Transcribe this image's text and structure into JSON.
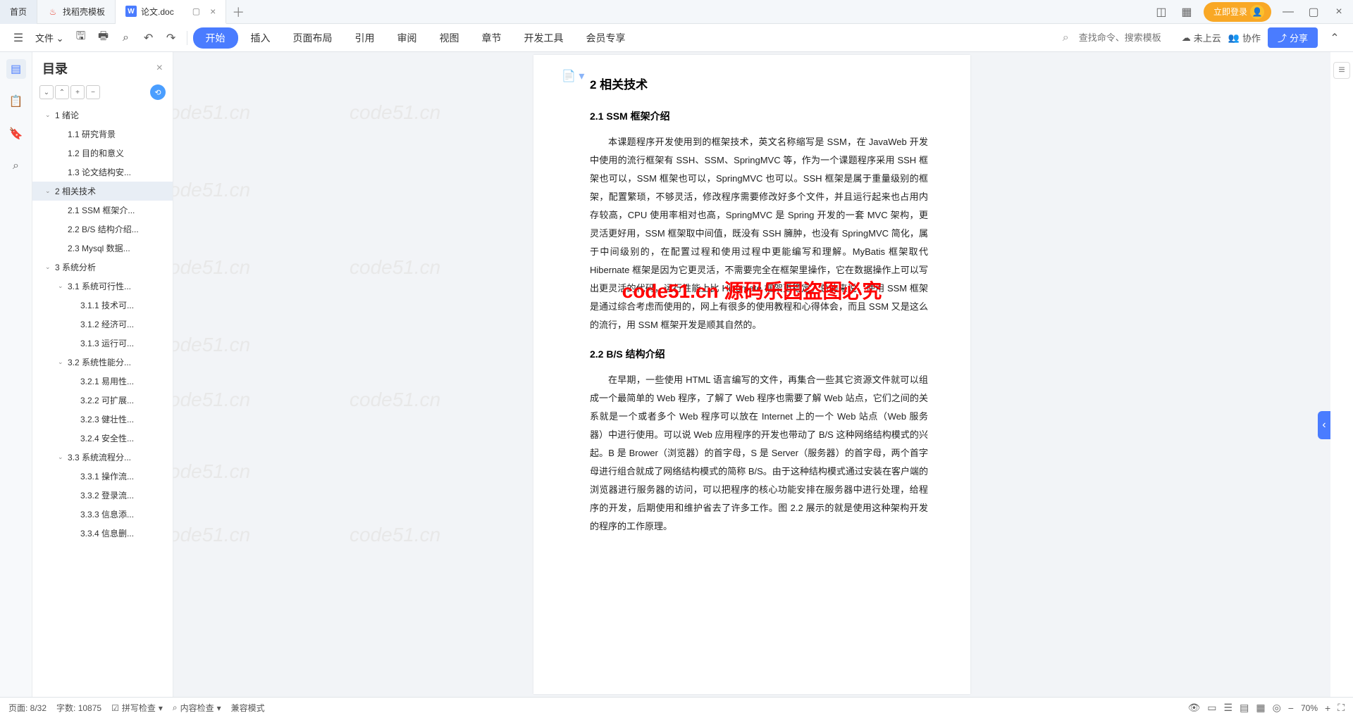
{
  "titlebar": {
    "home": "首页",
    "tab1": "找稻壳模板",
    "tab2": "论文.doc",
    "login": "立即登录"
  },
  "menubar": {
    "file": "文件",
    "tabs": [
      "开始",
      "插入",
      "页面布局",
      "引用",
      "审阅",
      "视图",
      "章节",
      "开发工具",
      "会员专享"
    ],
    "search_placeholder": "查找命令、搜索模板",
    "cloud": "未上云",
    "coop": "协作",
    "share": "分享"
  },
  "outline": {
    "title": "目录",
    "items": [
      {
        "lvl": 1,
        "caret": true,
        "label": "1 绪论"
      },
      {
        "lvl": 2,
        "label": "1.1 研究背景"
      },
      {
        "lvl": 2,
        "label": "1.2 目的和意义"
      },
      {
        "lvl": 2,
        "label": "1.3 论文结构安..."
      },
      {
        "lvl": 1,
        "caret": true,
        "label": "2 相关技术",
        "active": true
      },
      {
        "lvl": 2,
        "label": "2.1 SSM 框架介..."
      },
      {
        "lvl": 2,
        "label": "2.2 B/S 结构介绍..."
      },
      {
        "lvl": 2,
        "label": "2.3 Mysql 数据..."
      },
      {
        "lvl": 1,
        "caret": true,
        "label": "3 系统分析"
      },
      {
        "lvl": 2,
        "caret": true,
        "label": "3.1 系统可行性..."
      },
      {
        "lvl": 3,
        "label": "3.1.1 技术可..."
      },
      {
        "lvl": 3,
        "label": "3.1.2 经济可..."
      },
      {
        "lvl": 3,
        "label": "3.1.3 运行可..."
      },
      {
        "lvl": 2,
        "caret": true,
        "label": "3.2 系统性能分..."
      },
      {
        "lvl": 3,
        "label": "3.2.1 易用性..."
      },
      {
        "lvl": 3,
        "label": "3.2.2 可扩展..."
      },
      {
        "lvl": 3,
        "label": "3.2.3 健壮性..."
      },
      {
        "lvl": 3,
        "label": "3.2.4 安全性..."
      },
      {
        "lvl": 2,
        "caret": true,
        "label": "3.3 系统流程分..."
      },
      {
        "lvl": 3,
        "label": "3.3.1 操作流..."
      },
      {
        "lvl": 3,
        "label": "3.3.2 登录流..."
      },
      {
        "lvl": 3,
        "label": "3.3.3 信息添..."
      },
      {
        "lvl": 3,
        "label": "3.3.4 信息删..."
      }
    ]
  },
  "doc": {
    "h1": "2  相关技术",
    "h2a": "2.1 SSM 框架介绍",
    "p1": "本课题程序开发使用到的框架技术，英文名称缩写是 SSM，在 JavaWeb 开发中使用的流行框架有 SSH、SSM、SpringMVC 等，作为一个课题程序采用 SSH 框架也可以，SSM 框架也可以，SpringMVC 也可以。SSH 框架是属于重量级别的框架，配置繁琐，不够灵活，修改程序需要修改好多个文件，并且运行起来也占用内存较高，CPU 使用率相对也高，SpringMVC 是 Spring 开发的一套 MVC 架构，更灵活更好用，SSM 框架取中间值，既没有 SSH 臃肿，也没有 SpringMVC 简化，属于中间级别的，在配置过程和使用过程中更能编写和理解。MyBatis 框架取代 Hibernate 框架是因为它更灵活，不需要完全在框架里操作，它在数据操作上可以写出更灵活的代码，运行性能上比 Hibernate 框架更稳定。总的来说，使用 SSM 框架是通过综合考虑而使用的，网上有很多的使用教程和心得体会，而且 SSM 又是这么的流行，用 SSM 框架开发是顺其自然的。",
    "h2b": "2.2 B/S 结构介绍",
    "p2": "在早期，一些使用 HTML 语言编写的文件，再集合一些其它资源文件就可以组成一个最简单的 Web 程序，了解了 Web 程序也需要了解 Web 站点，它们之间的关系就是一个或者多个 Web 程序可以放在 Internet 上的一个 Web 站点（Web 服务器）中进行使用。可以说 Web 应用程序的开发也带动了 B/S 这种网络结构模式的兴起。B 是 Brower（浏览器）的首字母，S 是 Server（服务器）的首字母，两个首字母进行组合就成了网络结构模式的简称 B/S。由于这种结构模式通过安装在客户端的浏览器进行服务器的访问，可以把程序的核心功能安排在服务器中进行处理，给程序的开发，后期使用和维护省去了许多工作。图 2.2 展示的就是使用这种架构开发的程序的工作原理。"
  },
  "watermark": {
    "main": "code51.cn  源码乐园盗图必究",
    "grey": "code51.cn"
  },
  "statusbar": {
    "page": "页面: 8/32",
    "words": "字数: 10875",
    "spell": "拼写检查",
    "content": "内容检查",
    "compat": "兼容模式",
    "zoom": "70%"
  }
}
